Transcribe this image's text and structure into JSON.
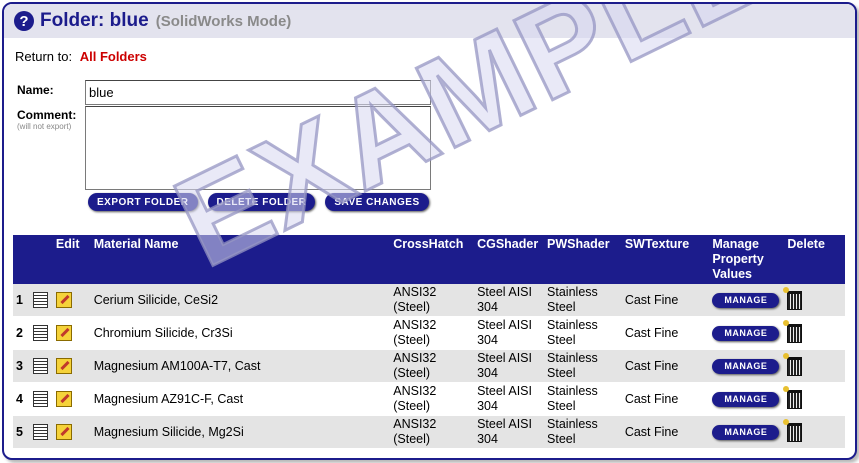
{
  "header": {
    "help_icon": "?",
    "title": "Folder: blue",
    "mode": "(SolidWorks Mode)"
  },
  "return": {
    "prefix": "Return to:",
    "link": "All Folders"
  },
  "form": {
    "name_label": "Name:",
    "name_value": "blue",
    "comment_label": "Comment:",
    "comment_note": "(will not export)",
    "comment_value": ""
  },
  "buttons": {
    "export": "EXPORT FOLDER",
    "delete": "DELETE FOLDER",
    "save": "SAVE CHANGES"
  },
  "table": {
    "columns": {
      "edit": "Edit",
      "material": "Material Name",
      "crosshatch": "CrossHatch",
      "cgshader": "CGShader",
      "pwshader": "PWShader",
      "swtexture": "SWTexture",
      "manage_l1": "Manage",
      "manage_l2": "Property",
      "manage_l3": "Values",
      "delete": "Delete"
    },
    "manage_label": "MANAGE",
    "rows": [
      {
        "num": "1",
        "material": "Cerium Silicide, CeSi2",
        "ch1": "ANSI32",
        "ch2": "(Steel)",
        "cg1": "Steel AISI",
        "cg2": "304",
        "pw1": "Stainless",
        "pw2": "Steel",
        "sw": "Cast Fine"
      },
      {
        "num": "2",
        "material": "Chromium Silicide, Cr3Si",
        "ch1": "ANSI32",
        "ch2": "(Steel)",
        "cg1": "Steel AISI",
        "cg2": "304",
        "pw1": "Stainless",
        "pw2": "Steel",
        "sw": "Cast Fine"
      },
      {
        "num": "3",
        "material": "Magnesium AM100A-T7, Cast",
        "ch1": "ANSI32",
        "ch2": "(Steel)",
        "cg1": "Steel AISI",
        "cg2": "304",
        "pw1": "Stainless",
        "pw2": "Steel",
        "sw": "Cast Fine"
      },
      {
        "num": "4",
        "material": "Magnesium AZ91C-F, Cast",
        "ch1": "ANSI32",
        "ch2": "(Steel)",
        "cg1": "Steel AISI",
        "cg2": "304",
        "pw1": "Stainless",
        "pw2": "Steel",
        "sw": "Cast Fine"
      },
      {
        "num": "5",
        "material": "Magnesium Silicide, Mg2Si",
        "ch1": "ANSI32",
        "ch2": "(Steel)",
        "cg1": "Steel AISI",
        "cg2": "304",
        "pw1": "Stainless",
        "pw2": "Steel",
        "sw": "Cast Fine"
      }
    ]
  },
  "watermark": "EXAMPLE",
  "colors": {
    "brand": "#1c1c8c",
    "link": "#cc0000",
    "row_alt": "#e4e4e4"
  }
}
